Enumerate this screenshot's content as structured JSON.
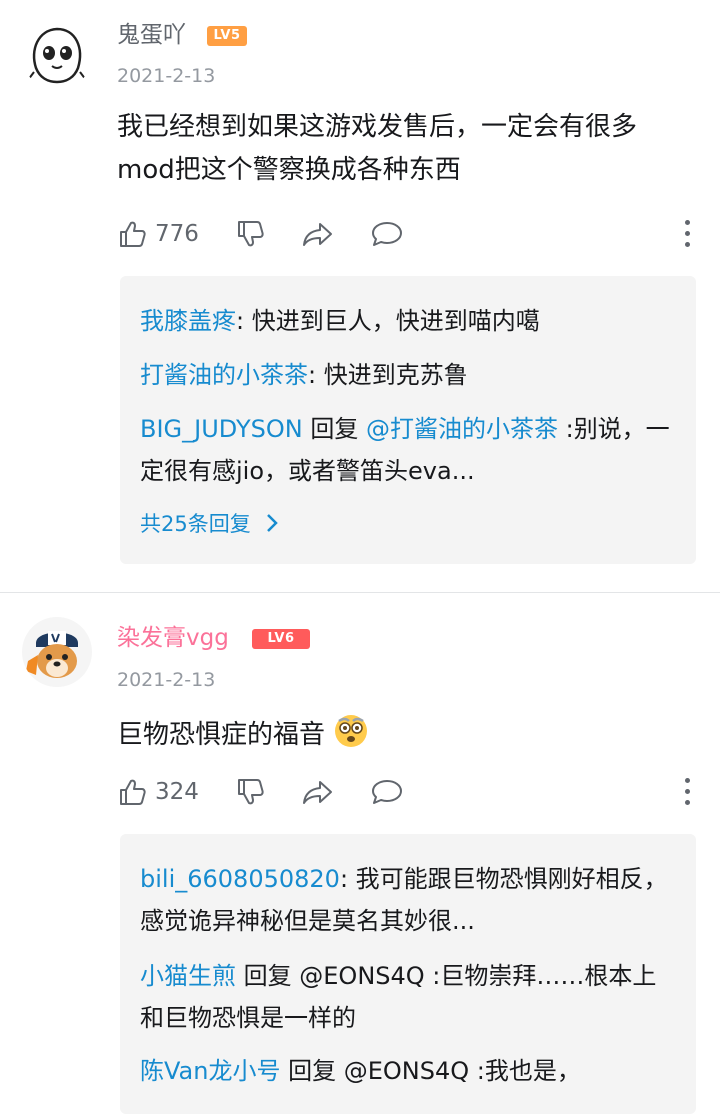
{
  "comments": [
    {
      "username": "鬼蛋吖",
      "level": "LV5",
      "date": "2021-2-13",
      "text": "我已经想到如果这游戏发售后，一定会有很多mod把这个警察换成各种东西",
      "likes": "776",
      "replies": [
        {
          "user": "我膝盖疼",
          "sep": ": ",
          "text": "快进到巨人，快进到喵内噶"
        },
        {
          "user": "打酱油的小茶茶",
          "sep": ": ",
          "text": "快进到克苏鲁"
        },
        {
          "user": "BIG_JUDYSON",
          "reply_word": " 回复 ",
          "mention": "@打酱油的小茶茶",
          "sep": " :",
          "text": "别说，一定很有感jio，或者警笛头eva..."
        }
      ],
      "more_replies": "共25条回复"
    },
    {
      "username": "染发膏vgg",
      "level": "LV6",
      "date": "2021-2-13",
      "text": "巨物恐惧症的福音",
      "emoji": "astonished-face",
      "likes": "324",
      "replies": [
        {
          "user": "bili_6608050820",
          "sep": ": ",
          "text": "我可能跟巨物恐惧刚好相反，感觉诡异神秘但是莫名其妙很..."
        },
        {
          "user": "小猫生煎",
          "reply_word": " 回复 ",
          "mention": "@EONS4Q",
          "sep": " :",
          "text": "巨物崇拜……根本上和巨物恐惧是一样的"
        },
        {
          "user": "陈Van龙小号",
          "reply_word": " 回复 ",
          "mention": "@EONS4Q",
          "sep": " :",
          "text": "我也是，"
        }
      ]
    }
  ],
  "colors": {
    "link_blue": "#178bcf",
    "vip_pink": "#fb7299",
    "lv5_orange": "#ff9f43",
    "lv6_red": "#ff5b5b"
  }
}
